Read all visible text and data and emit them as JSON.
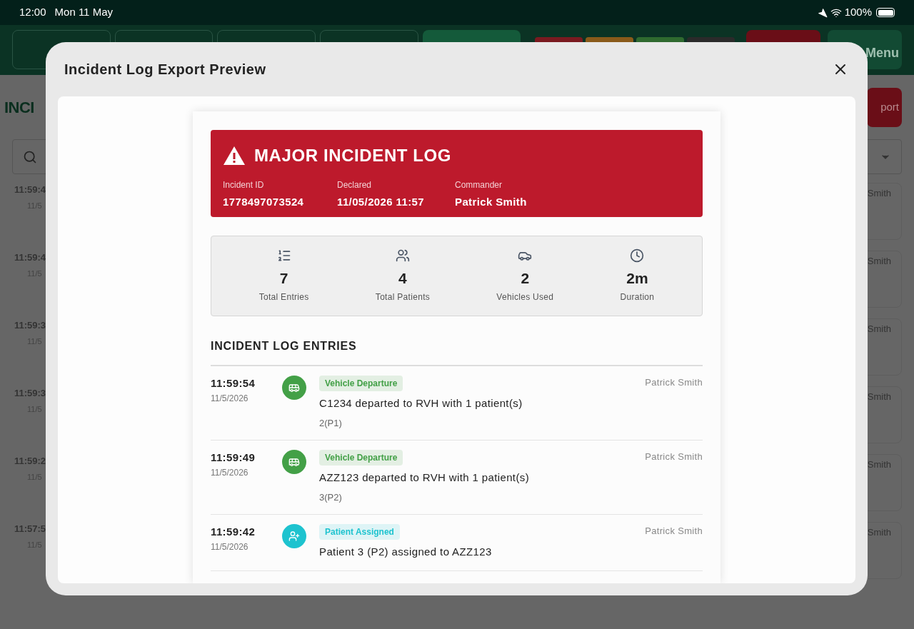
{
  "status_bar": {
    "time": "12:00",
    "date": "Mon 11 May",
    "battery": "100%"
  },
  "background": {
    "nav_tabs": [
      {
        "selected": false
      },
      {
        "selected": false
      },
      {
        "selected": false
      },
      {
        "selected": false
      },
      {
        "selected": true
      }
    ],
    "menu_label": "Menu",
    "page_title": "INCI",
    "export_label": "port",
    "rows": [
      {
        "time": "11:59:4",
        "date": "11/5",
        "user": "Smith"
      },
      {
        "time": "11:59:4",
        "date": "11/5",
        "user": "Smith"
      },
      {
        "time": "11:59:3",
        "date": "11/5",
        "user": "Smith"
      },
      {
        "time": "11:59:3",
        "date": "11/5",
        "user": "Smith"
      },
      {
        "time": "11:59:2",
        "date": "11/5",
        "user": "Smith"
      },
      {
        "time": "11:57:5",
        "date": "11/5",
        "user": "Smith"
      }
    ]
  },
  "dialog": {
    "title": "Incident Log Export Preview",
    "banner": {
      "title": "MAJOR INCIDENT LOG",
      "fields": [
        {
          "label": "Incident ID",
          "value": "1778497073524"
        },
        {
          "label": "Declared",
          "value": "11/05/2026 11:57"
        },
        {
          "label": "Commander",
          "value": "Patrick Smith"
        }
      ]
    },
    "stats": [
      {
        "kind": "entries",
        "value": "7",
        "label": "Total Entries"
      },
      {
        "kind": "patients",
        "value": "4",
        "label": "Total Patients"
      },
      {
        "kind": "vehicles",
        "value": "2",
        "label": "Vehicles Used"
      },
      {
        "kind": "duration",
        "value": "2m",
        "label": "Duration"
      }
    ],
    "section_title": "INCIDENT LOG ENTRIES",
    "entries": [
      {
        "kind": "vehicle",
        "color": "#43a047",
        "time": "11:59:54",
        "date": "11/5/2026",
        "tag": "Vehicle Departure",
        "text": "C1234 departed to RVH with 1 patient(s)",
        "detail": "2(P1)",
        "user": "Patrick Smith"
      },
      {
        "kind": "vehicle",
        "color": "#43a047",
        "time": "11:59:49",
        "date": "11/5/2026",
        "tag": "Vehicle Departure",
        "text": "AZZ123 departed to RVH with 1 patient(s)",
        "detail": "3(P2)",
        "user": "Patrick Smith"
      },
      {
        "kind": "patient",
        "color": "#1ec3cf",
        "time": "11:59:42",
        "date": "11/5/2026",
        "tag": "Patient Assigned",
        "text": "Patient 3 (P2) assigned to AZZ123",
        "user": "Patrick Smith"
      }
    ]
  }
}
